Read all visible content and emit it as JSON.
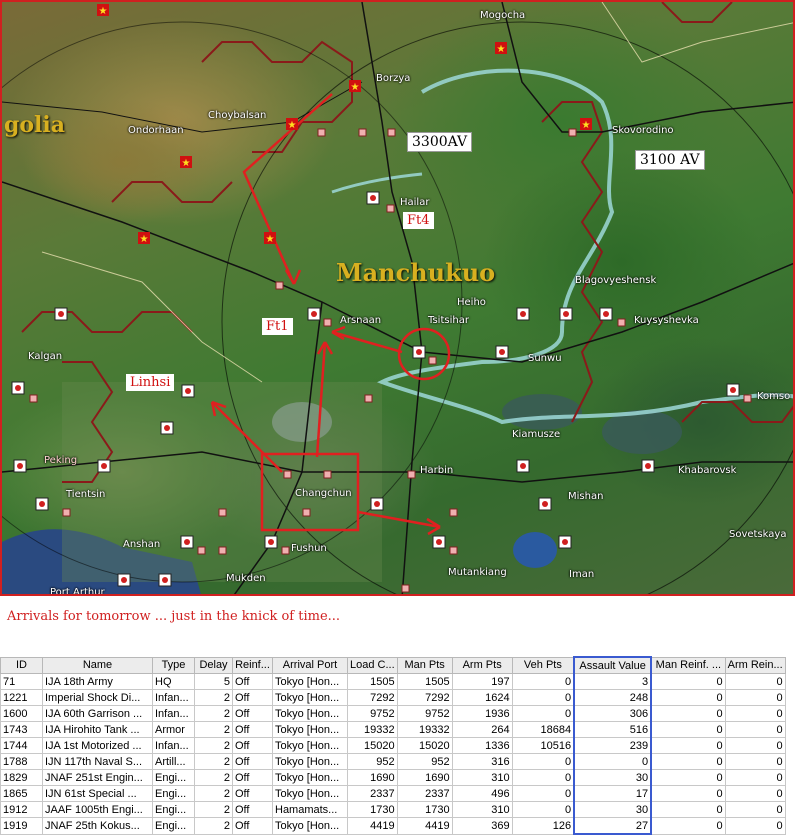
{
  "map": {
    "region_labels": {
      "mongolia": "golia",
      "manchukuo": "Manchukuo"
    },
    "cities": [
      {
        "key": "mogocha",
        "name": "Mogocha"
      },
      {
        "key": "borzya",
        "name": "Borzya"
      },
      {
        "key": "choybalsan",
        "name": "Choybalsan"
      },
      {
        "key": "ondorhaan",
        "name": "Ondorhaan"
      },
      {
        "key": "skovorodino",
        "name": "Skovorodino"
      },
      {
        "key": "hailar",
        "name": "Hailar"
      },
      {
        "key": "blagovyeshensk",
        "name": "Blagovyeshensk"
      },
      {
        "key": "heiho",
        "name": "Heiho"
      },
      {
        "key": "arsnaan",
        "name": "Arsnaan"
      },
      {
        "key": "tsitsihar",
        "name": "Tsitsihar"
      },
      {
        "key": "kuysyshevka",
        "name": "Kuysyshevka"
      },
      {
        "key": "sunwu",
        "name": "Sunwu"
      },
      {
        "key": "kalgan",
        "name": "Kalgan"
      },
      {
        "key": "komso",
        "name": "Komso"
      },
      {
        "key": "kiamusze",
        "name": "Kiamusze"
      },
      {
        "key": "peking",
        "name": "Peking"
      },
      {
        "key": "harbin",
        "name": "Harbin"
      },
      {
        "key": "khabarovsk",
        "name": "Khabarovsk"
      },
      {
        "key": "tientsin",
        "name": "Tientsin"
      },
      {
        "key": "changchun",
        "name": "Changchun"
      },
      {
        "key": "mishan",
        "name": "Mishan"
      },
      {
        "key": "anshan",
        "name": "Anshan"
      },
      {
        "key": "fushun",
        "name": "Fushun"
      },
      {
        "key": "sovetskaya",
        "name": "Sovetskaya"
      },
      {
        "key": "mutankiang",
        "name": "Mutankiang"
      },
      {
        "key": "iman",
        "name": "Iman"
      },
      {
        "key": "mukden",
        "name": "Mukden"
      },
      {
        "key": "port_arthur",
        "name": "Port Arthur"
      }
    ],
    "annotations": {
      "av_3300": "3300AV",
      "av_3100": "3100 AV",
      "ft4": "Ft4",
      "ft1": "Ft1",
      "linhsi": "Linhsi"
    },
    "colors": {
      "arrow": "#e02020",
      "border": "#d02020",
      "hex_border": "#8a1a1a",
      "river": "#9ed8d8"
    }
  },
  "caption": "Arrivals for tomorrow ... just in the knick of time...",
  "table": {
    "columns": [
      "ID",
      "Name",
      "Type",
      "Delay",
      "Reinf...",
      "Arrival Port",
      "Load C...",
      "Man Pts",
      "Arm Pts",
      "Veh Pts",
      "Assault Value",
      "Man Reinf. ...",
      "Arm Rein..."
    ],
    "highlight_column": "Assault Value",
    "rows": [
      {
        "id": "71",
        "name": "IJA 18th Army",
        "type": "HQ",
        "delay": "5",
        "reinf": "Off",
        "port": "Tokyo [Hon...",
        "load": "1505",
        "man": "1505",
        "arm": "197",
        "veh": "0",
        "av": "3",
        "man_reinf": "0",
        "arm_reinf": "0"
      },
      {
        "id": "1221",
        "name": "Imperial Shock Di...",
        "type": "Infan...",
        "delay": "2",
        "reinf": "Off",
        "port": "Tokyo [Hon...",
        "load": "7292",
        "man": "7292",
        "arm": "1624",
        "veh": "0",
        "av": "248",
        "man_reinf": "0",
        "arm_reinf": "0"
      },
      {
        "id": "1600",
        "name": "IJA 60th Garrison ...",
        "type": "Infan...",
        "delay": "2",
        "reinf": "Off",
        "port": "Tokyo [Hon...",
        "load": "9752",
        "man": "9752",
        "arm": "1936",
        "veh": "0",
        "av": "306",
        "man_reinf": "0",
        "arm_reinf": "0"
      },
      {
        "id": "1743",
        "name": "IJA Hirohito Tank ...",
        "type": "Armor",
        "delay": "2",
        "reinf": "Off",
        "port": "Tokyo [Hon...",
        "load": "19332",
        "man": "19332",
        "arm": "264",
        "veh": "18684",
        "av": "516",
        "man_reinf": "0",
        "arm_reinf": "0"
      },
      {
        "id": "1744",
        "name": "IJA 1st Motorized ...",
        "type": "Infan...",
        "delay": "2",
        "reinf": "Off",
        "port": "Tokyo [Hon...",
        "load": "15020",
        "man": "15020",
        "arm": "1336",
        "veh": "10516",
        "av": "239",
        "man_reinf": "0",
        "arm_reinf": "0"
      },
      {
        "id": "1788",
        "name": "IJN 117th Naval S...",
        "type": "Artill...",
        "delay": "2",
        "reinf": "Off",
        "port": "Tokyo [Hon...",
        "load": "952",
        "man": "952",
        "arm": "316",
        "veh": "0",
        "av": "0",
        "man_reinf": "0",
        "arm_reinf": "0"
      },
      {
        "id": "1829",
        "name": "JNAF 251st Engin...",
        "type": "Engi...",
        "delay": "2",
        "reinf": "Off",
        "port": "Tokyo [Hon...",
        "load": "1690",
        "man": "1690",
        "arm": "310",
        "veh": "0",
        "av": "30",
        "man_reinf": "0",
        "arm_reinf": "0"
      },
      {
        "id": "1865",
        "name": "IJN 61st Special ...",
        "type": "Engi...",
        "delay": "2",
        "reinf": "Off",
        "port": "Tokyo [Hon...",
        "load": "2337",
        "man": "2337",
        "arm": "496",
        "veh": "0",
        "av": "17",
        "man_reinf": "0",
        "arm_reinf": "0"
      },
      {
        "id": "1912",
        "name": "JAAF 1005th Engi...",
        "type": "Engi...",
        "delay": "2",
        "reinf": "Off",
        "port": "Hamamats...",
        "load": "1730",
        "man": "1730",
        "arm": "310",
        "veh": "0",
        "av": "30",
        "man_reinf": "0",
        "arm_reinf": "0"
      },
      {
        "id": "1919",
        "name": "JNAF 25th Kokus...",
        "type": "Engi...",
        "delay": "2",
        "reinf": "Off",
        "port": "Tokyo [Hon...",
        "load": "4419",
        "man": "4419",
        "arm": "369",
        "veh": "126",
        "av": "27",
        "man_reinf": "0",
        "arm_reinf": "0"
      }
    ]
  }
}
